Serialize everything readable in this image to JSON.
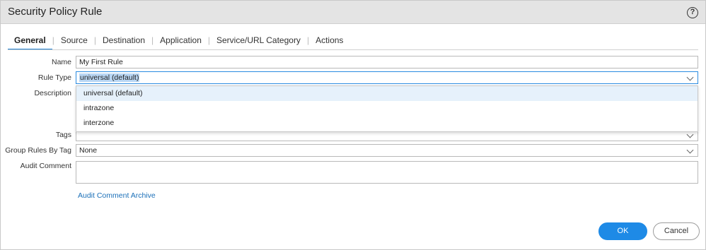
{
  "dialog": {
    "title": "Security Policy Rule",
    "help_icon": "question-circle-icon"
  },
  "tabs": [
    {
      "label": "General",
      "active": true
    },
    {
      "label": "Source"
    },
    {
      "label": "Destination"
    },
    {
      "label": "Application"
    },
    {
      "label": "Service/URL Category"
    },
    {
      "label": "Actions"
    }
  ],
  "form": {
    "name": {
      "label": "Name",
      "value": "My First Rule"
    },
    "rule_type": {
      "label": "Rule Type",
      "value": "universal (default)",
      "options": [
        "universal (default)",
        "intrazone",
        "interzone"
      ],
      "highlighted_option": "universal (default)"
    },
    "description": {
      "label": "Description",
      "value": ""
    },
    "tags": {
      "label": "Tags",
      "value": ""
    },
    "group_rules_by_tag": {
      "label": "Group Rules By Tag",
      "value": "None"
    },
    "audit_comment": {
      "label": "Audit Comment",
      "value": ""
    },
    "audit_comment_archive_link": "Audit Comment Archive"
  },
  "buttons": {
    "ok": "OK",
    "cancel": "Cancel"
  },
  "colors": {
    "accent": "#1e8ae6",
    "tab_underline": "#1e7fd3",
    "link": "#1a6fb8",
    "selection": "#b9d6f3"
  }
}
